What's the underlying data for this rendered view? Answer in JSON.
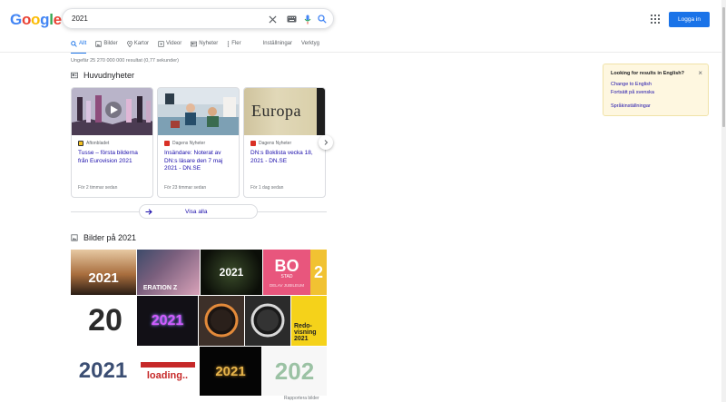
{
  "logo": {
    "letters": [
      "G",
      "o",
      "o",
      "g",
      "l",
      "e"
    ],
    "colors": [
      "#4285f4",
      "#ea4335",
      "#fbbc05",
      "#4285f4",
      "#34a853",
      "#ea4335"
    ]
  },
  "search": {
    "value": "2021"
  },
  "header": {
    "login_label": "Logga in",
    "login_color": "#1a73e8"
  },
  "tabs": [
    {
      "label": "Allt",
      "icon": "search-icon",
      "active": true
    },
    {
      "label": "Bilder",
      "icon": "image-icon"
    },
    {
      "label": "Kartor",
      "icon": "map-pin-icon"
    },
    {
      "label": "Videor",
      "icon": "video-icon"
    },
    {
      "label": "Nyheter",
      "icon": "news-icon"
    },
    {
      "label": "Fler",
      "icon": "more-vert-icon"
    },
    {
      "label": "Inställningar"
    },
    {
      "label": "Verktyg"
    }
  ],
  "result_stats": "Ungefär 25 270 000 000 resultat (0,77 sekunder)",
  "news": {
    "title": "Huvudnyheter",
    "cards": [
      {
        "source": "Aftonbladet",
        "title": "Tusse – första bilderna från Eurovision 2021",
        "time": "För 2 timmar sedan",
        "source_color": "#e3a21a"
      },
      {
        "source": "Dagens Nyheter",
        "title": "Insändare: Noterat av DN:s läsare den 7 maj 2021 - DN.SE",
        "time": "För 23 timmar sedan",
        "source_color": "#d93025"
      },
      {
        "source": "Dagens Nyheter",
        "title": "DN:s Boklista vecka 18, 2021 - DN.SE",
        "time": "För 1 dag sedan",
        "source_color": "#d93025",
        "image_text": "Europa"
      }
    ],
    "see_all": "Visa alla"
  },
  "images": {
    "title": "Bilder på 2021",
    "tile_texts": [
      "2021",
      "ERATION Z",
      "2021",
      "BO",
      "2",
      "20",
      "2021",
      "Redo-\nvisning\n2021",
      "2021",
      "loading..",
      "2021",
      "202",
      "STAD",
      "DELAV JUBILEUM"
    ],
    "footer": "Rapportera bilder"
  },
  "lang": {
    "question": "Looking for results in English?",
    "link_english": "Change to English",
    "link_swedish": "Fortsätt på svenska",
    "link_settings": "Språkinställningar"
  }
}
